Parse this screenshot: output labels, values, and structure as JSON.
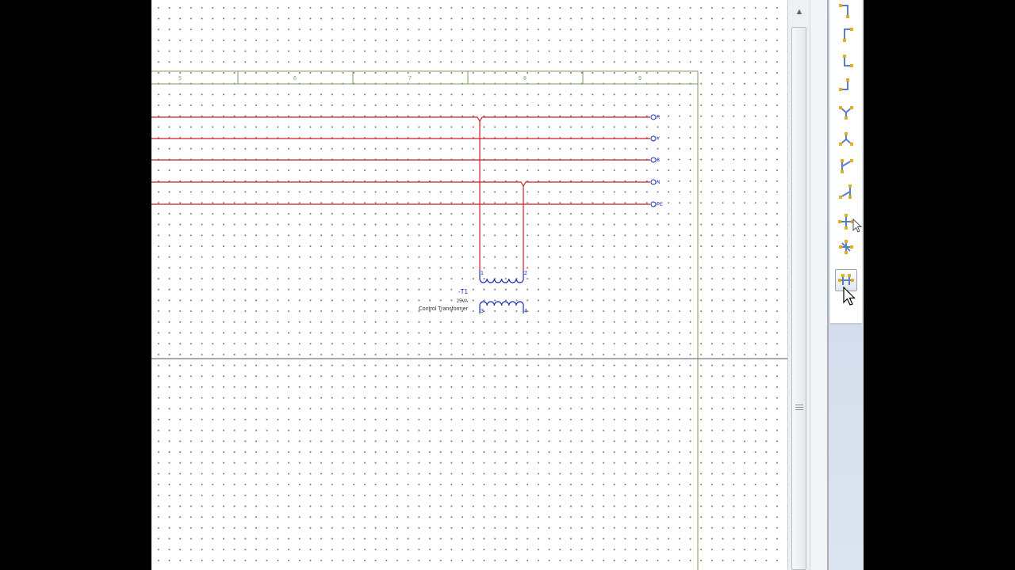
{
  "sheet": {
    "column_numbers": [
      "5",
      "6",
      "7",
      "8",
      "9"
    ],
    "wire_labels": [
      "R",
      "Y",
      "B",
      "N",
      "PE"
    ],
    "colors": {
      "wire": "#d01c24",
      "component": "#1a2fb0",
      "border": "#7a9a5a"
    }
  },
  "transformer": {
    "tag": "-T1",
    "rating": "25VA",
    "description": "Control Transformer",
    "pins": [
      "1",
      "2",
      "3",
      "4"
    ]
  },
  "scrollbar": {
    "up_icon": "arrow-up-icon",
    "up_glyph": "▲"
  },
  "toolbar": {
    "tools": [
      {
        "name": "wire-corner-down-left-icon"
      },
      {
        "name": "wire-corner-down-right-icon"
      },
      {
        "name": "wire-corner-up-right-icon"
      },
      {
        "name": "wire-corner-up-left-icon"
      },
      {
        "name": "wire-tee-down-icon"
      },
      {
        "name": "wire-tee-up-icon"
      },
      {
        "name": "wire-tee-right-icon"
      },
      {
        "name": "wire-tee-left-icon"
      },
      {
        "name": "wire-cross-icon"
      },
      {
        "name": "wire-junction-icon"
      },
      {
        "name": "wire-bridge-icon",
        "active": true
      }
    ],
    "colors": {
      "wire": "#5a7fc4",
      "node": "#e0b020"
    }
  }
}
